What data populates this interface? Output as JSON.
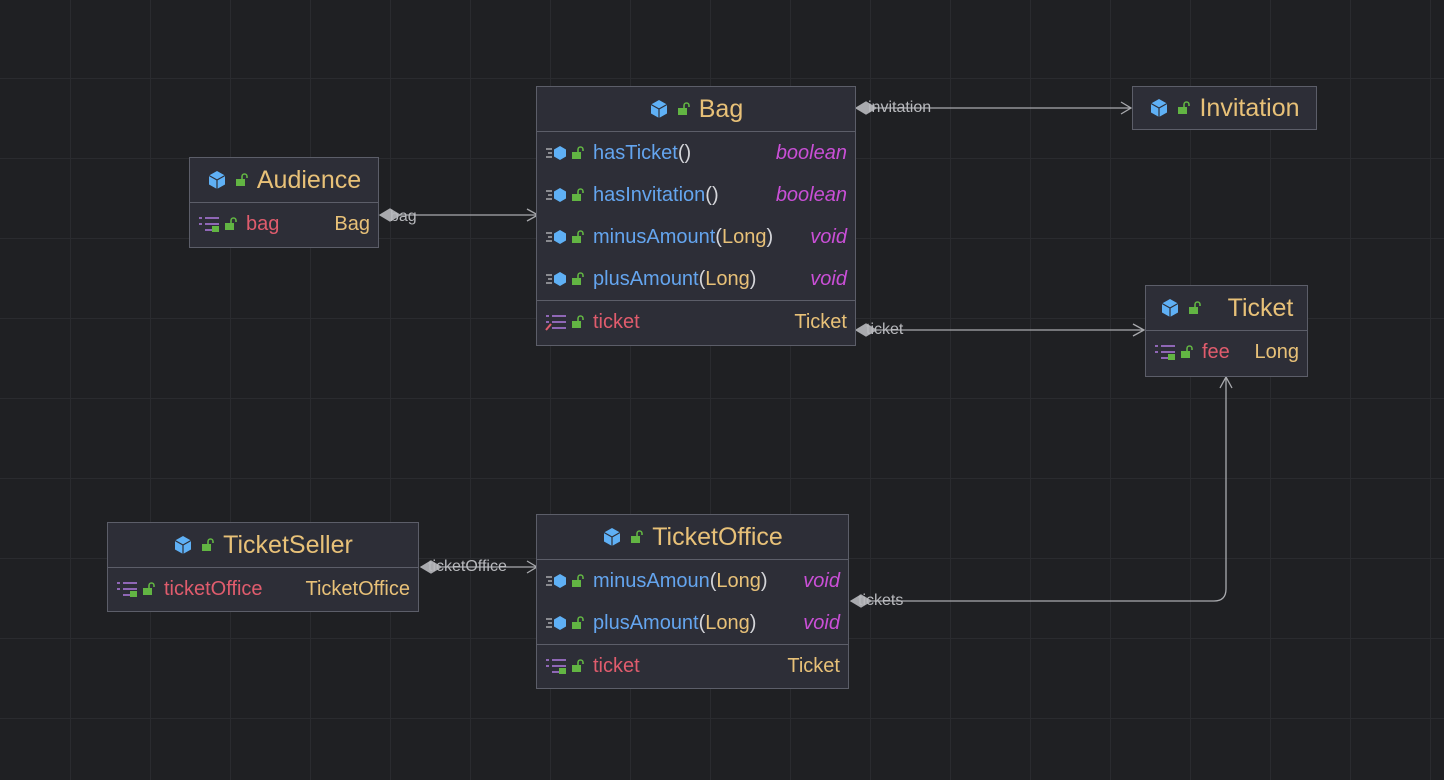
{
  "classes": {
    "bag": {
      "name": "Bag",
      "methods": [
        {
          "name": "hasTicket",
          "open": "(",
          "param": "",
          "close": ")",
          "ret": "boolean"
        },
        {
          "name": "hasInvitation",
          "open": "(",
          "param": "",
          "close": ")",
          "ret": "boolean"
        },
        {
          "name": "minusAmount",
          "open": "(",
          "param": "Long",
          "close": ")",
          "ret": "void"
        },
        {
          "name": "plusAmount",
          "open": "(",
          "param": "Long",
          "close": ")",
          "ret": "void"
        }
      ],
      "fields": [
        {
          "name": "ticket",
          "type": "Ticket"
        }
      ]
    },
    "audience": {
      "name": "Audience",
      "fields": [
        {
          "name": "bag",
          "type": "Bag"
        }
      ]
    },
    "invitation": {
      "name": "Invitation"
    },
    "ticket": {
      "name": "Ticket",
      "fields": [
        {
          "name": "fee",
          "type": "Long"
        }
      ]
    },
    "ticket_seller": {
      "name": "TicketSeller",
      "fields": [
        {
          "name": "ticketOffice",
          "type": "TicketOffice"
        }
      ]
    },
    "ticket_office": {
      "name": "TicketOffice",
      "methods": [
        {
          "name": "minusAmoun",
          "open": "(",
          "param": "Long",
          "close": ")",
          "ret": "void"
        },
        {
          "name": "plusAmount",
          "open": "(",
          "param": "Long",
          "close": ")",
          "ret": "void"
        }
      ],
      "fields": [
        {
          "name": "ticket",
          "type": "Ticket"
        }
      ]
    }
  },
  "edges": {
    "invitation": "invitation",
    "bag": "bag",
    "ticket": "ticket",
    "ticket_office": "ticketOffice",
    "tickets": "tickets"
  },
  "colors": {
    "background": "#1f2023",
    "node_fill": "#2d2e37",
    "node_border": "#5c5e69",
    "class_name": "#e8c178",
    "method_name": "#64a5ef",
    "field_name": "#e05c6d",
    "return_type": "#c94fd6",
    "edge": "#a9aaae"
  },
  "icons": {
    "class": "class-cube-icon",
    "visibility": "public-lock-icon",
    "method": "method-icon",
    "field": "field-icon"
  }
}
